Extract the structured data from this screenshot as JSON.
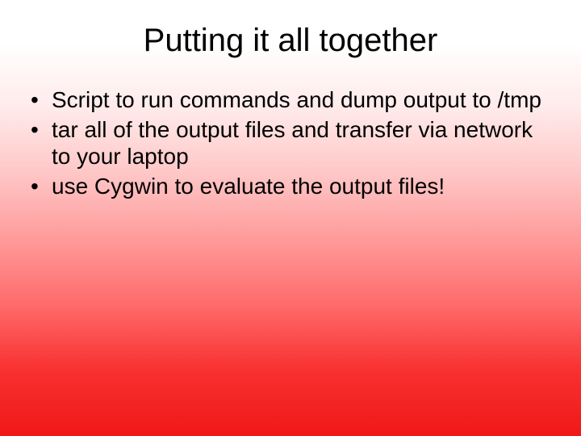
{
  "title": "Putting it all together",
  "bullets": [
    "Script to run commands and dump output to /tmp",
    "tar all of the output files and transfer via network to your laptop",
    "use Cygwin to evaluate the output files!"
  ]
}
